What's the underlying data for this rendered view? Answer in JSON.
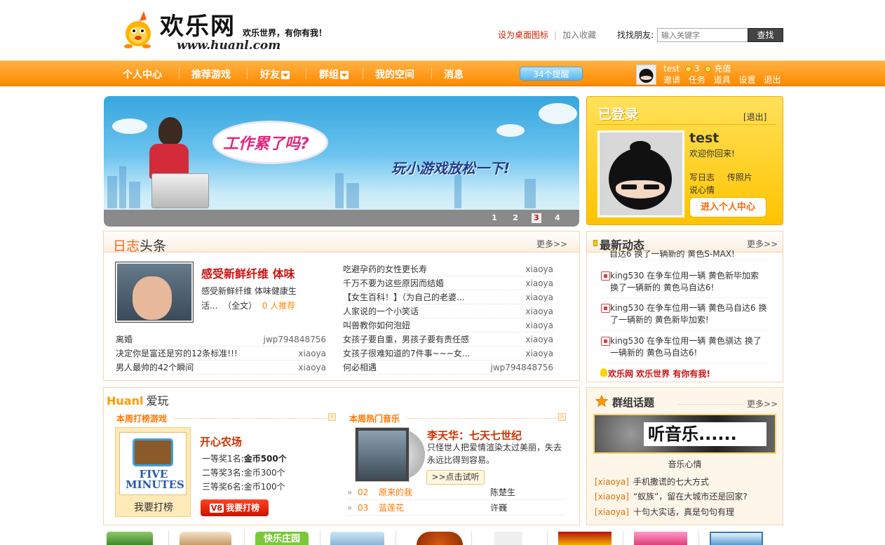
{
  "header": {
    "logo_cn": "欢乐网",
    "slogan": "欢乐世界，有你有我！",
    "url": "www.huanl.com",
    "set_desktop": "设为桌面图标",
    "add_fav": "加入收藏",
    "find_friends_label": "找找朋友:",
    "search_placeholder": "输入关键字",
    "search_button": "查找"
  },
  "nav": {
    "items": [
      "个人中心",
      "推荐游戏",
      "好友",
      "群组",
      "我的空间",
      "消息"
    ],
    "reminder": "34个提醒",
    "user": "test",
    "coins": "3",
    "recharge": "充值",
    "links": [
      "邀请",
      "任务",
      "道具",
      "设置",
      "退出"
    ]
  },
  "banner": {
    "bubble_text": "工作累了吗?",
    "slogan": "玩小游戏放松一下!",
    "pages": [
      "1",
      "2",
      "3",
      "4"
    ],
    "active_page": "3"
  },
  "login": {
    "title": "已登录",
    "exit": "[退出]",
    "username": "test",
    "welcome": "欢迎你回来!",
    "actions": [
      "写日志",
      "传照片"
    ],
    "mood": "说心情",
    "enter_button": "进入个人中心"
  },
  "diary": {
    "title_part1": "日志",
    "title_part2": "头条",
    "more": "更多>>",
    "feature_title": "感受新鲜纤维  体味",
    "feature_desc": "感受新鲜纤维 体味健康生活...",
    "feature_full": "（全文）",
    "feature_rec": "0 人推荐",
    "left_list": [
      {
        "title": "离婚",
        "user": "jwp794848756"
      },
      {
        "title": "决定你是富还是穷的12条标准!!!",
        "user": "xiaoya"
      },
      {
        "title": "男人最帅的42个瞬间",
        "user": "xiaoya"
      }
    ],
    "right_list": [
      {
        "title": "吃避孕药的女性更长寿",
        "user": "xiaoya"
      },
      {
        "title": "千万不要为这些原因而结婚",
        "user": "xiaoya"
      },
      {
        "title": "【女生百科！】（为自己的老婆...",
        "user": "xiaoya"
      },
      {
        "title": "人家说的一个小笑话",
        "user": "xiaoya"
      },
      {
        "title": "叫兽教你如何泡妞",
        "user": "xiaoya"
      },
      {
        "title": "女孩子要自重，男孩子要有责任感",
        "user": "xiaoya"
      },
      {
        "title": "女孩子很难知道的7件事~~~女...",
        "user": "xiaoya"
      },
      {
        "title": "何必相遇",
        "user": "jwp794848756"
      }
    ]
  },
  "activity": {
    "title": "最新动态",
    "more": "更多>>",
    "partial_top": "自达6 换了一辆新的 黄色S-MAX!",
    "items": [
      "king530 在争车位用一辆 黄色新毕加索 换了一辆新的 黄色马自达6!",
      "king530 在争车位用一辆 黄色马自达6 换了一辆新的 黄色新毕加索!",
      "king530 在争车位用一辆 黄色骐达 换了一辆新的 黄色马自达6!"
    ],
    "slogan": "欢乐网 欢乐世界 有你有我!"
  },
  "huanl": {
    "title_en": "Huanl",
    "title_cn": "爱玩",
    "game_section": "本周打榜游戏",
    "music_section": "本周热门音乐",
    "game_logo_text": "FIVE MINUTES",
    "game_play": "我要打榜",
    "game_name": "开心农场",
    "prizes": [
      {
        "rank": "一等奖1名:",
        "prize": "金币500个"
      },
      {
        "rank": "二等奖3名:",
        "prize": "金币300个"
      },
      {
        "rank": "三等奖6名:",
        "prize": "金币100个"
      }
    ],
    "rank_button": "我要打榜",
    "rank_badge": "V8",
    "song_title": "李天华：七天七世纪",
    "song_desc": "只怪世人把爱情渲染太过美丽，失去永远比得到容易。",
    "try_button": ">>点击试听",
    "songs": [
      {
        "no": "02",
        "name": "原来的我",
        "singer": "陈楚生"
      },
      {
        "no": "03",
        "name": "蓝莲花",
        "singer": "许巍"
      }
    ]
  },
  "group": {
    "title": "群组话题",
    "more": "更多>>",
    "banner_text": "听音乐......",
    "caption": "音乐心情",
    "topics": [
      {
        "user": "[xiaoya]",
        "text": "手机撒谎的七大方式"
      },
      {
        "user": "[xiaoya]",
        "text": "“蚁族”，留在大城市还是回家?"
      },
      {
        "user": "[xiaoya]",
        "text": "十句大实话，真是句句有理"
      }
    ]
  },
  "strip": {
    "item3_text": "快乐庄园"
  }
}
